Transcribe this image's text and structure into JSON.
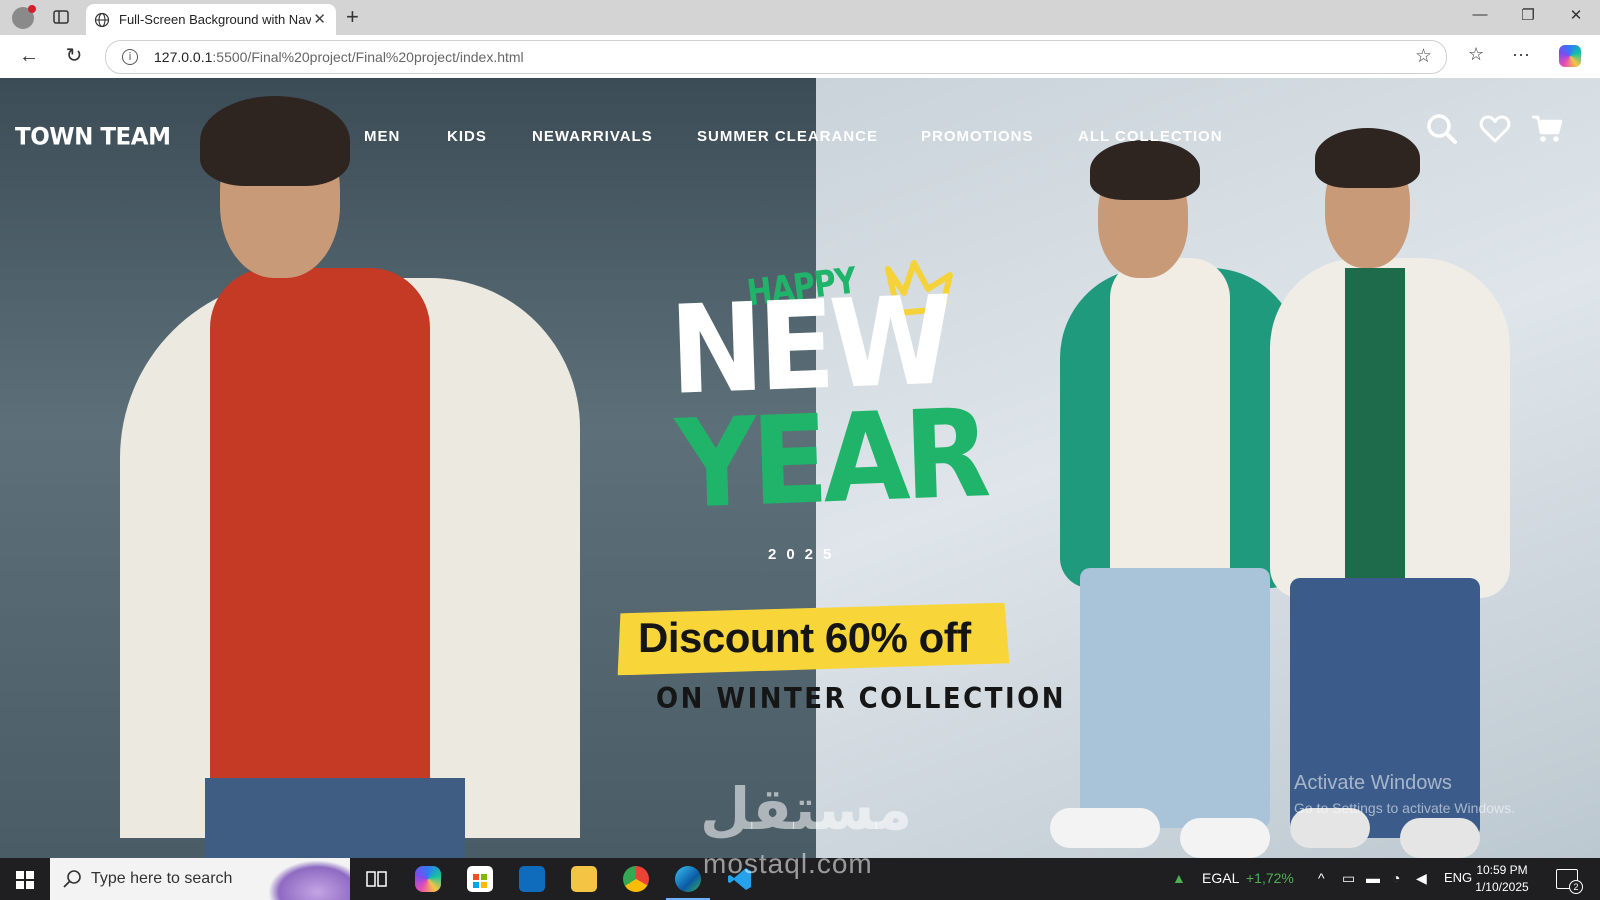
{
  "browser": {
    "tab_title": "Full-Screen Background with Navi",
    "url_host": "127.0.0.1",
    "url_rest": ":5500/Final%20project/Final%20project/index.html"
  },
  "site": {
    "logo": "TOWN TEAM",
    "nav": [
      "MEN",
      "KIDS",
      "NEWARRIVALS",
      "SUMMER CLEARANCE",
      "PROMOTIONS",
      "ALL COLLECTION"
    ]
  },
  "hero": {
    "happy": "HAPPY",
    "new": "NEW",
    "year": "YEAR",
    "year_number": "2025",
    "discount": "Discount 60% off",
    "collection": "ON WINTER COLLECTION"
  },
  "overlay": {
    "activate_title": "Activate Windows",
    "activate_sub": "Go to Settings to activate Windows.",
    "watermark_arabic": "مستقل",
    "watermark_domain": "mostaql.com"
  },
  "taskbar": {
    "search_placeholder": "Type here to search",
    "stock_name": "EGAL",
    "stock_change": "+1,72%",
    "language": "ENG",
    "time": "10:59 PM",
    "date": "1/10/2025",
    "notification_count": "2"
  },
  "colors": {
    "accent_green": "#20b46a",
    "discount_yellow": "#f8d63a"
  }
}
